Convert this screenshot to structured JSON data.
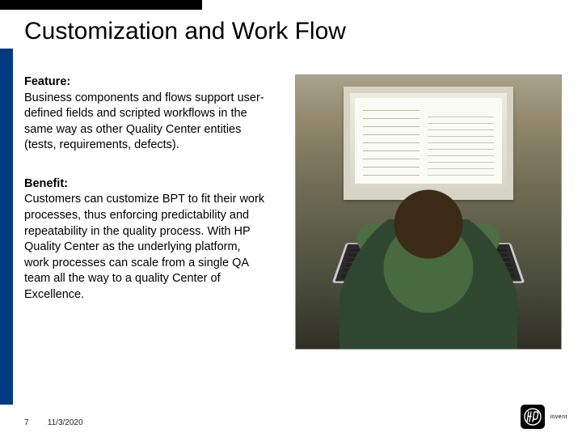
{
  "title": "Customization and Work Flow",
  "feature": {
    "label": "Feature:",
    "text": "Business components and flows support user-defined fields and scripted workflows in the same way as other Quality Center entities (tests, requirements, defects)."
  },
  "benefit": {
    "label": "Benefit:",
    "text": "Customers can customize BPT to fit their work processes, thus enforcing predictability and repeatability in the quality process. With HP Quality Center as the underlying platform, work processes can scale from a single QA team all the way to a quality Center of Excellence."
  },
  "footer": {
    "page": "7",
    "date": "11/3/2020"
  },
  "brand": {
    "word": "invent"
  }
}
